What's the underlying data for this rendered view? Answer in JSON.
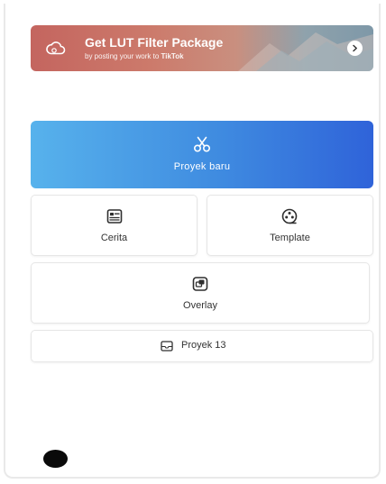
{
  "banner": {
    "title": "Get LUT Filter Package",
    "subtitle_prefix": "by posting your work to ",
    "subtitle_brand": "TikTok",
    "icon": "cloud-icon",
    "arrow_icon": "chevron-right-icon"
  },
  "main_actions": {
    "new_project": {
      "label": "Proyek baru",
      "icon": "scissors-icon"
    },
    "cerita": {
      "label": "Cerita",
      "icon": "story-icon"
    },
    "template": {
      "label": "Template",
      "icon": "film-reel-icon"
    },
    "overlay": {
      "label": "Overlay",
      "icon": "overlay-icon"
    },
    "projects": {
      "label": "Proyek 13",
      "icon": "projects-icon"
    }
  },
  "colors": {
    "accent_start": "#57b2ec",
    "accent_end": "#2f63d9",
    "banner_start": "#c4655f",
    "banner_end": "#7e98a8"
  }
}
